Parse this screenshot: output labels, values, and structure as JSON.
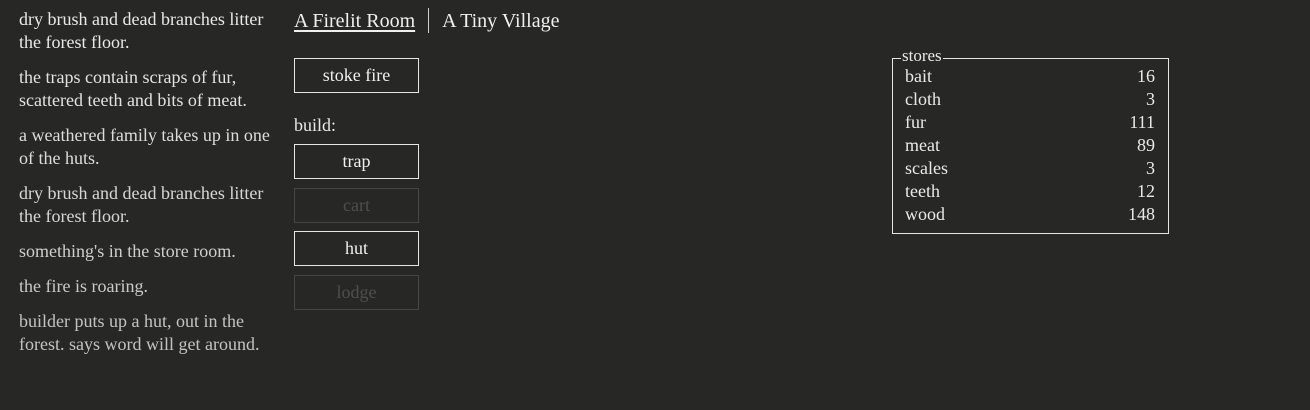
{
  "notifications": [
    "dry brush and dead branches litter the forest floor.",
    "the traps contain scraps of fur, scattered teeth and bits of meat.",
    "a weathered family takes up in one of the huts.",
    "dry brush and dead branches litter the forest floor.",
    "something's in the store room.",
    "the fire is roaring.",
    "builder puts up a hut, out in the forest. says word will get around."
  ],
  "header": {
    "tabs": [
      {
        "label": "A Firelit Room",
        "selected": true
      },
      {
        "label": "A Tiny Village",
        "selected": false
      }
    ]
  },
  "actions": {
    "stoke_fire": "stoke fire",
    "build_label": "build:",
    "build_items": [
      {
        "label": "trap",
        "enabled": true
      },
      {
        "label": "cart",
        "enabled": false
      },
      {
        "label": "hut",
        "enabled": true
      },
      {
        "label": "lodge",
        "enabled": false
      }
    ]
  },
  "stores": {
    "title": "stores",
    "items": [
      {
        "name": "bait",
        "count": "16"
      },
      {
        "name": "cloth",
        "count": "3"
      },
      {
        "name": "fur",
        "count": "111"
      },
      {
        "name": "meat",
        "count": "89"
      },
      {
        "name": "scales",
        "count": "3"
      },
      {
        "name": "teeth",
        "count": "12"
      },
      {
        "name": "wood",
        "count": "148"
      }
    ]
  },
  "colors": {
    "background": "#272725",
    "text": "#e9e9e6",
    "disabled": "#4f4f4c"
  }
}
